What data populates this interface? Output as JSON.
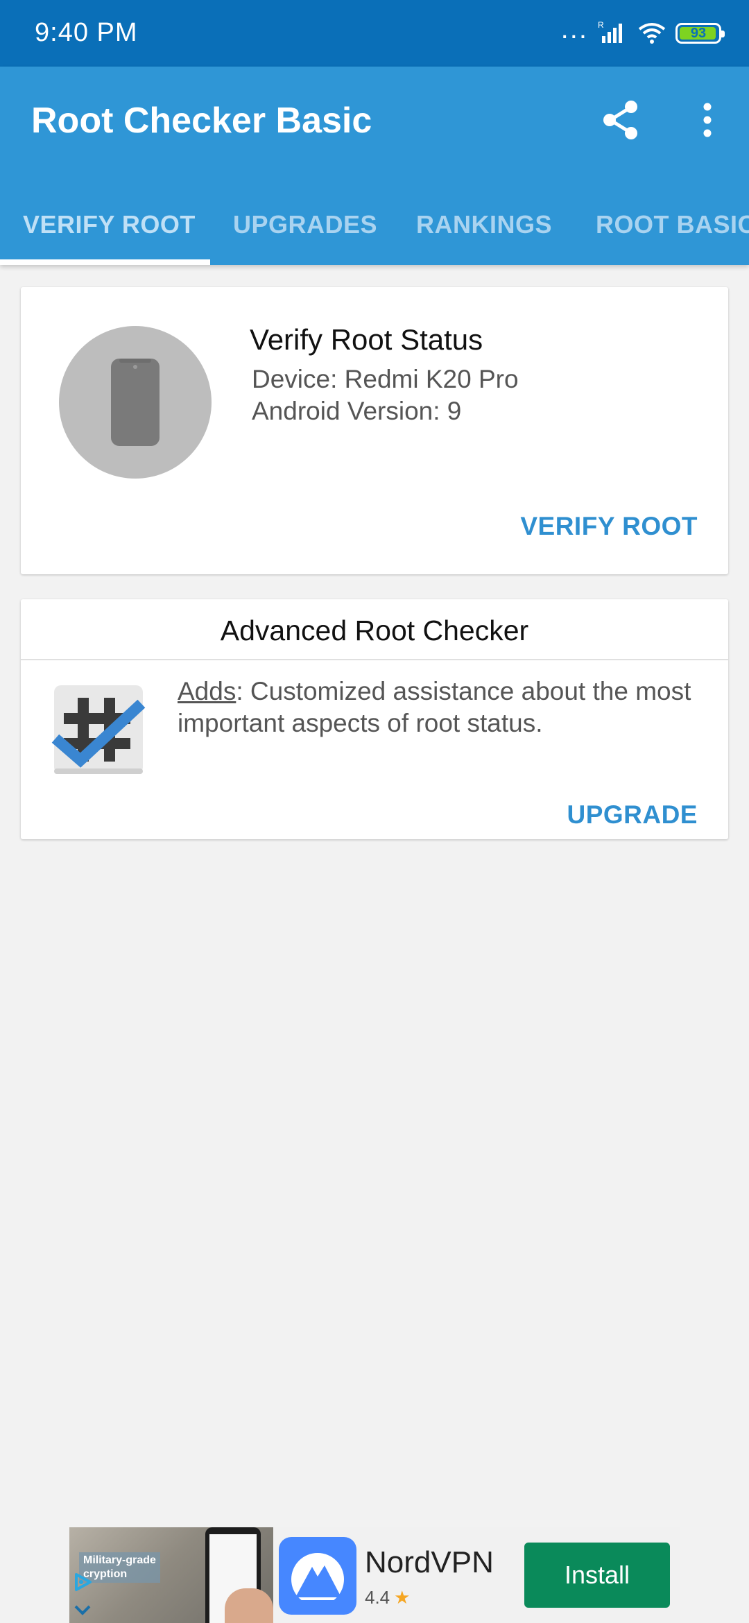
{
  "status_bar": {
    "time": "9:40  PM",
    "dots": "...",
    "battery": "93"
  },
  "app_bar": {
    "title": "Root Checker Basic",
    "tabs": [
      "VERIFY ROOT",
      "UPGRADES",
      "RANKINGS",
      "ROOT BASICS"
    ],
    "active_tab": 0
  },
  "verify_card": {
    "title": "Verify Root Status",
    "device": "Device: Redmi K20 Pro",
    "android_version": "Android Version: 9",
    "action": "VERIFY ROOT"
  },
  "advanced_card": {
    "title": "Advanced Root Checker",
    "adds_label": "Adds",
    "adds_text": ": Customized assistance about the most important aspects of root status.",
    "action": "UPGRADE"
  },
  "ad": {
    "overlay_line1": "Military-grade",
    "overlay_line2": "cryption",
    "name": "NordVPN",
    "rating": "4.4",
    "install_label": "Install"
  },
  "colors": {
    "status_bar": "#0a6fb8",
    "app_bar": "#2f96d6",
    "accent": "#2f8fd0",
    "install_button": "#0a8a5a"
  }
}
